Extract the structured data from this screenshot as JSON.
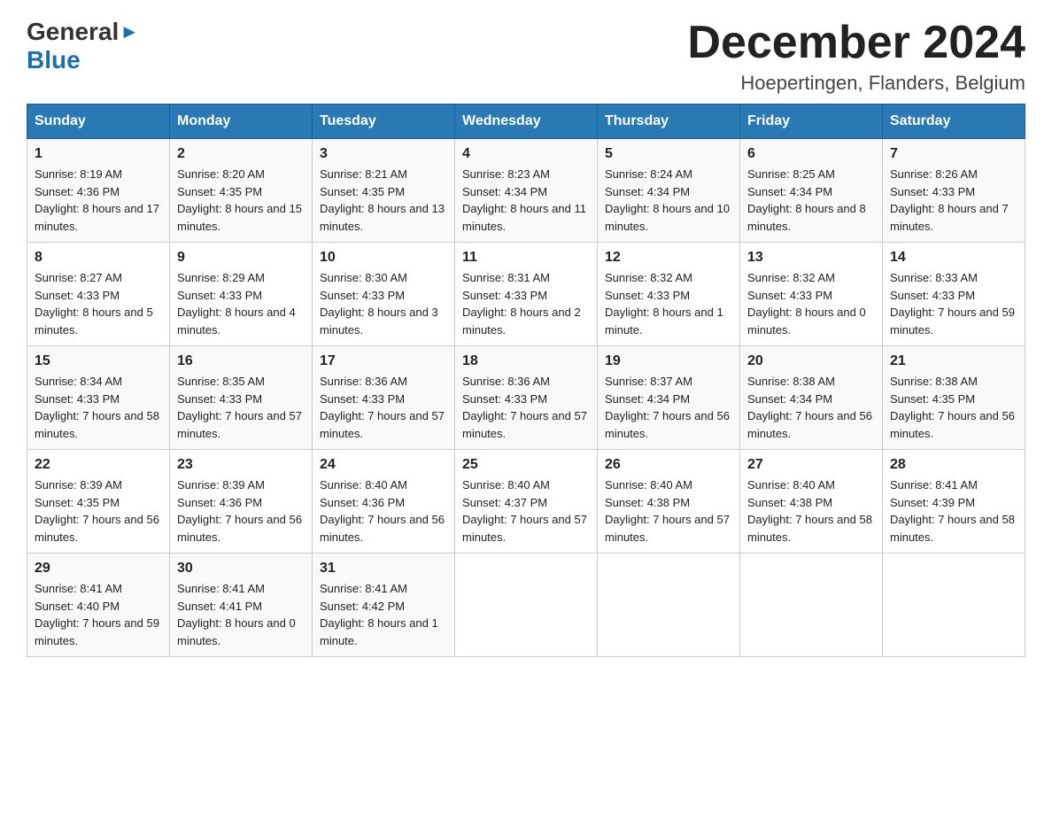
{
  "header": {
    "logo_general": "General",
    "logo_blue": "Blue",
    "month_title": "December 2024",
    "location": "Hoepertingen, Flanders, Belgium"
  },
  "weekdays": [
    "Sunday",
    "Monday",
    "Tuesday",
    "Wednesday",
    "Thursday",
    "Friday",
    "Saturday"
  ],
  "weeks": [
    [
      {
        "day": "1",
        "sunrise": "Sunrise: 8:19 AM",
        "sunset": "Sunset: 4:36 PM",
        "daylight": "Daylight: 8 hours and 17 minutes."
      },
      {
        "day": "2",
        "sunrise": "Sunrise: 8:20 AM",
        "sunset": "Sunset: 4:35 PM",
        "daylight": "Daylight: 8 hours and 15 minutes."
      },
      {
        "day": "3",
        "sunrise": "Sunrise: 8:21 AM",
        "sunset": "Sunset: 4:35 PM",
        "daylight": "Daylight: 8 hours and 13 minutes."
      },
      {
        "day": "4",
        "sunrise": "Sunrise: 8:23 AM",
        "sunset": "Sunset: 4:34 PM",
        "daylight": "Daylight: 8 hours and 11 minutes."
      },
      {
        "day": "5",
        "sunrise": "Sunrise: 8:24 AM",
        "sunset": "Sunset: 4:34 PM",
        "daylight": "Daylight: 8 hours and 10 minutes."
      },
      {
        "day": "6",
        "sunrise": "Sunrise: 8:25 AM",
        "sunset": "Sunset: 4:34 PM",
        "daylight": "Daylight: 8 hours and 8 minutes."
      },
      {
        "day": "7",
        "sunrise": "Sunrise: 8:26 AM",
        "sunset": "Sunset: 4:33 PM",
        "daylight": "Daylight: 8 hours and 7 minutes."
      }
    ],
    [
      {
        "day": "8",
        "sunrise": "Sunrise: 8:27 AM",
        "sunset": "Sunset: 4:33 PM",
        "daylight": "Daylight: 8 hours and 5 minutes."
      },
      {
        "day": "9",
        "sunrise": "Sunrise: 8:29 AM",
        "sunset": "Sunset: 4:33 PM",
        "daylight": "Daylight: 8 hours and 4 minutes."
      },
      {
        "day": "10",
        "sunrise": "Sunrise: 8:30 AM",
        "sunset": "Sunset: 4:33 PM",
        "daylight": "Daylight: 8 hours and 3 minutes."
      },
      {
        "day": "11",
        "sunrise": "Sunrise: 8:31 AM",
        "sunset": "Sunset: 4:33 PM",
        "daylight": "Daylight: 8 hours and 2 minutes."
      },
      {
        "day": "12",
        "sunrise": "Sunrise: 8:32 AM",
        "sunset": "Sunset: 4:33 PM",
        "daylight": "Daylight: 8 hours and 1 minute."
      },
      {
        "day": "13",
        "sunrise": "Sunrise: 8:32 AM",
        "sunset": "Sunset: 4:33 PM",
        "daylight": "Daylight: 8 hours and 0 minutes."
      },
      {
        "day": "14",
        "sunrise": "Sunrise: 8:33 AM",
        "sunset": "Sunset: 4:33 PM",
        "daylight": "Daylight: 7 hours and 59 minutes."
      }
    ],
    [
      {
        "day": "15",
        "sunrise": "Sunrise: 8:34 AM",
        "sunset": "Sunset: 4:33 PM",
        "daylight": "Daylight: 7 hours and 58 minutes."
      },
      {
        "day": "16",
        "sunrise": "Sunrise: 8:35 AM",
        "sunset": "Sunset: 4:33 PM",
        "daylight": "Daylight: 7 hours and 57 minutes."
      },
      {
        "day": "17",
        "sunrise": "Sunrise: 8:36 AM",
        "sunset": "Sunset: 4:33 PM",
        "daylight": "Daylight: 7 hours and 57 minutes."
      },
      {
        "day": "18",
        "sunrise": "Sunrise: 8:36 AM",
        "sunset": "Sunset: 4:33 PM",
        "daylight": "Daylight: 7 hours and 57 minutes."
      },
      {
        "day": "19",
        "sunrise": "Sunrise: 8:37 AM",
        "sunset": "Sunset: 4:34 PM",
        "daylight": "Daylight: 7 hours and 56 minutes."
      },
      {
        "day": "20",
        "sunrise": "Sunrise: 8:38 AM",
        "sunset": "Sunset: 4:34 PM",
        "daylight": "Daylight: 7 hours and 56 minutes."
      },
      {
        "day": "21",
        "sunrise": "Sunrise: 8:38 AM",
        "sunset": "Sunset: 4:35 PM",
        "daylight": "Daylight: 7 hours and 56 minutes."
      }
    ],
    [
      {
        "day": "22",
        "sunrise": "Sunrise: 8:39 AM",
        "sunset": "Sunset: 4:35 PM",
        "daylight": "Daylight: 7 hours and 56 minutes."
      },
      {
        "day": "23",
        "sunrise": "Sunrise: 8:39 AM",
        "sunset": "Sunset: 4:36 PM",
        "daylight": "Daylight: 7 hours and 56 minutes."
      },
      {
        "day": "24",
        "sunrise": "Sunrise: 8:40 AM",
        "sunset": "Sunset: 4:36 PM",
        "daylight": "Daylight: 7 hours and 56 minutes."
      },
      {
        "day": "25",
        "sunrise": "Sunrise: 8:40 AM",
        "sunset": "Sunset: 4:37 PM",
        "daylight": "Daylight: 7 hours and 57 minutes."
      },
      {
        "day": "26",
        "sunrise": "Sunrise: 8:40 AM",
        "sunset": "Sunset: 4:38 PM",
        "daylight": "Daylight: 7 hours and 57 minutes."
      },
      {
        "day": "27",
        "sunrise": "Sunrise: 8:40 AM",
        "sunset": "Sunset: 4:38 PM",
        "daylight": "Daylight: 7 hours and 58 minutes."
      },
      {
        "day": "28",
        "sunrise": "Sunrise: 8:41 AM",
        "sunset": "Sunset: 4:39 PM",
        "daylight": "Daylight: 7 hours and 58 minutes."
      }
    ],
    [
      {
        "day": "29",
        "sunrise": "Sunrise: 8:41 AM",
        "sunset": "Sunset: 4:40 PM",
        "daylight": "Daylight: 7 hours and 59 minutes."
      },
      {
        "day": "30",
        "sunrise": "Sunrise: 8:41 AM",
        "sunset": "Sunset: 4:41 PM",
        "daylight": "Daylight: 8 hours and 0 minutes."
      },
      {
        "day": "31",
        "sunrise": "Sunrise: 8:41 AM",
        "sunset": "Sunset: 4:42 PM",
        "daylight": "Daylight: 8 hours and 1 minute."
      },
      null,
      null,
      null,
      null
    ]
  ]
}
